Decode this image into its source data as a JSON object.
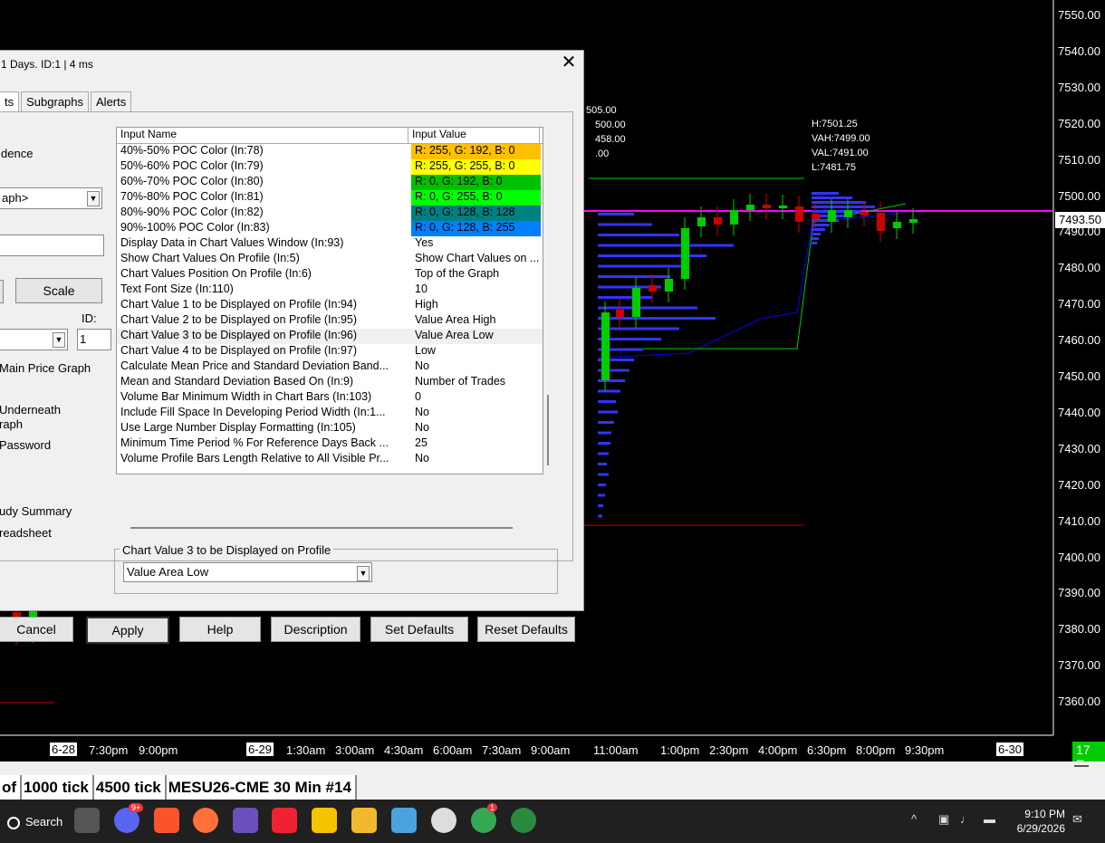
{
  "chart": {
    "y_ticks": [
      "7550.00",
      "7540.00",
      "7530.00",
      "7520.00",
      "7510.00",
      "7500.00",
      "7490.00",
      "7480.00",
      "7470.00",
      "7460.00",
      "7450.00",
      "7440.00",
      "7430.00",
      "7420.00",
      "7410.00",
      "7400.00",
      "7390.00",
      "7380.00",
      "7370.00",
      "7360.00"
    ],
    "last_price": "7493.50",
    "x_labels": [
      "7:30pm",
      "9:00pm",
      "1:30am",
      "3:00am",
      "4:30am",
      "6:00am",
      "7:30am",
      "9:00am",
      "11:00am",
      "1:00pm",
      "2:30pm",
      "4:00pm",
      "6:30pm",
      "8:00pm",
      "9:30pm"
    ],
    "date_markers": [
      "6-28",
      "6-29",
      "6-30"
    ],
    "left_hints": [
      "505.00",
      "500.00",
      "458.00",
      ".00"
    ],
    "ohlc": {
      "high": "H:7501.25",
      "vah": "VAH:7499.00",
      "val": "VAL:7491.00",
      "low": "L:7481.75"
    },
    "tz_badge": "17 E",
    "colors": {
      "poc_line": "#ff00ff",
      "volume_profile": "#3333ff",
      "vwap": "#0000ff",
      "band": "#00cc00",
      "up_candle": "#00cc00",
      "down_candle": "#cc0000"
    }
  },
  "status": {
    "tabs": [
      "of",
      "1000 tick",
      "4500 tick",
      "MESU26-CME  30 Min  #14"
    ]
  },
  "taskbar": {
    "search": "Search",
    "time": "9:10 PM",
    "date": "6/29/2026",
    "discord_badge": "9+",
    "chrome_badge": "1",
    "icons": [
      "discord-icon",
      "brave-icon",
      "firefox-icon",
      "vpn-icon",
      "ninjatrader-icon",
      "sticky-notes-icon",
      "file-explorer-icon",
      "notepad-icon",
      "clock-icon",
      "chrome-icon",
      "globe-icon"
    ]
  },
  "dialog": {
    "title": "1 Days. ID:1 | 4 ms",
    "tabs": [
      "ts",
      "Subgraphs",
      "Alerts"
    ],
    "left_labels": {
      "dence": "dence",
      "graph": "aph>",
      "scale": "Scale",
      "id": "ID:",
      "id_value": "1",
      "main": "Main Price Graph",
      "underneath": "Underneath",
      "graph2": "raph",
      "password": "Password",
      "summary": "udy Summary",
      "spreadsheet": "readsheet"
    },
    "grid": {
      "headers": [
        "Input Name",
        "Input Value"
      ],
      "rows": [
        {
          "name": "40%-50% POC Color   (In:78)",
          "value": "R: 255, G: 192, B: 0",
          "color": "#ffc000",
          "text_color": "#000"
        },
        {
          "name": "50%-60% POC Color   (In:79)",
          "value": "R: 255, G: 255, B: 0",
          "color": "#ffff00",
          "text_color": "#000"
        },
        {
          "name": "60%-70% POC Color   (In:80)",
          "value": "R: 0, G: 192, B: 0",
          "color": "#00c000",
          "text_color": "#000"
        },
        {
          "name": "70%-80% POC Color   (In:81)",
          "value": "R: 0, G: 255, B: 0",
          "color": "#00ff00",
          "text_color": "#000"
        },
        {
          "name": "80%-90% POC Color   (In:82)",
          "value": "R: 0, G: 128, B: 128",
          "color": "#008080",
          "text_color": "#000"
        },
        {
          "name": "90%-100% POC Color   (In:83)",
          "value": "R: 0, G: 128, B: 255",
          "color": "#0080ff",
          "text_color": "#000"
        },
        {
          "name": "Display Data in Chart Values Window   (In:93)",
          "value": "Yes"
        },
        {
          "name": "Show Chart Values On Profile   (In:5)",
          "value": "Show Chart Values on ..."
        },
        {
          "name": "Chart Values Position On Profile   (In:6)",
          "value": "Top of the Graph"
        },
        {
          "name": "Text Font Size   (In:110)",
          "value": "10"
        },
        {
          "name": "Chart Value 1 to be Displayed on Profile   (In:94)",
          "value": "High"
        },
        {
          "name": "Chart Value 2 to be Displayed on Profile   (In:95)",
          "value": "Value Area High"
        },
        {
          "name": "Chart Value 3 to be Displayed on Profile   (In:96)",
          "value": "Value Area Low",
          "selected": true
        },
        {
          "name": "Chart Value 4 to be Displayed on Profile   (In:97)",
          "value": "Low"
        },
        {
          "name": "Calculate Mean Price and Standard Deviation Band...",
          "value": "No"
        },
        {
          "name": "Mean and Standard Deviation Based On   (In:9)",
          "value": "Number of Trades"
        },
        {
          "name": "Volume Bar Minimum Width in Chart Bars   (In:103)",
          "value": "0"
        },
        {
          "name": "Include Fill Space In Developing Period Width   (In:1...",
          "value": "No"
        },
        {
          "name": "Use Large Number Display Formatting   (In:105)",
          "value": "No"
        },
        {
          "name": "Minimum Time Period % For Reference Days Back ...",
          "value": "25"
        },
        {
          "name": "Volume Profile Bars Length Relative to All Visible Pr...",
          "value": "No"
        }
      ]
    },
    "group_label": "Chart Value 3 to be Displayed on Profile",
    "group_value": "Value Area Low",
    "buttons": [
      "Cancel",
      "Apply",
      "Help",
      "Description",
      "Set Defaults",
      "Reset Defaults"
    ]
  }
}
